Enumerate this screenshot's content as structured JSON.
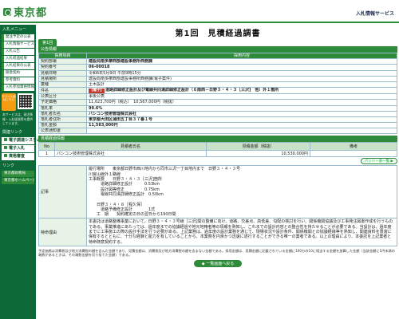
{
  "header": {
    "logo_text": "東京都",
    "right_title": "入札情報サービス"
  },
  "sidebar": {
    "menu_caption": "入札メニュー",
    "items": [
      "発注予定の公表",
      "入札情報サービス",
      "入札公告",
      "入札経過結果",
      "入札結果の公表",
      "随意契約",
      "参考資料",
      "入札参加資格情報"
    ],
    "mobile_text": "モバイル版はこちら",
    "note": "本サービスは、発注情報・入札経過等を提供しています。",
    "sys_caption": "関連リンク",
    "sys_items": [
      "電子調達システム(TOP)",
      "電子入札",
      "資格審査"
    ],
    "link_caption": "リンク",
    "links": [
      "東京都財務局",
      "東京都ホームページ"
    ]
  },
  "main": {
    "title": "第1回　見積経過調書",
    "tab": "第1回",
    "info_section": "公告情報",
    "col_item": "採用項目",
    "col_content": "採用内容",
    "rows": [
      {
        "label": "契約部署",
        "value": "建設局南多摩西部建設事務所西務課"
      },
      {
        "label": "契約番号",
        "value": "06-00018"
      },
      {
        "label": "見積日時",
        "value": "令和6年5月9日 午前9時15分"
      },
      {
        "label": "見積場所",
        "value": "建設局南多摩西部建設事務所西務課(電子案件)"
      },
      {
        "label": "業種",
        "value": "土木設計"
      },
      {
        "label": "件名",
        "tag": "【電子】",
        "value": "道路詳細修正設計及び電線共同溝詳細修正設計（６南西－日野３・４・３［三沢]　他）外１箇所"
      },
      {
        "label": "公表区分",
        "value": "事後公表"
      },
      {
        "label": "予定価格",
        "value": "11,623,700円（税込）　10,567,000円（税抜）"
      },
      {
        "label": "落札率",
        "value": "99.6%"
      },
      {
        "label": "落札者氏名",
        "value": "パシコン技術管理株式会社"
      },
      {
        "label": "落札者住所",
        "value": "東京都大田区蒲田五丁目３７番１号"
      },
      {
        "label": "落札金額",
        "value": "11,583,000円"
      },
      {
        "label": "公表通知書",
        "value": ""
      }
    ],
    "result_section": "見積経過情報",
    "result_cols": [
      "No",
      "見積者氏名",
      "見積金額（税抜）",
      "備考"
    ],
    "result_rows": [
      {
        "no": "1",
        "name": "パシコン技術管理株式会社",
        "amount": "10,530,000円",
        "note": ""
      }
    ],
    "detail_button": "パッシー表一覧",
    "notes_label": "記事",
    "notes": "履行場所　　東京都日野市西川地内から同市三沢一丁目地内まで　日野３・４・３号\n川宮山線外１路線\n工事概要　　日野３・４・３［三沢]箇所\n　　　道路詳細修正設計　　　0.53km\n　　　設計図等修正　　　　　0.75km\n　　　電線共同溝詳細修正設計　0.50km\n\n　　日野３・４・８［程久保］\n　　　道路予備修正設計　　　　1式\n　　工　期　　契約確定の日の翌日から190日間",
    "special_label": "特命理由",
    "special": "本委託は道路整備事業において、日野３・４・３号線［三沢]間の整備に向け、道路、交差点、高低差、勾配の検討を行い、関係機関協議及び工事発注図書作成を行うものである。事業推進にあたっては、過年度までの協議経過や地元地権者等の情報を熟知し、これまでの設計内容との整合性を持たせることが必要である。当設計は、過年度までに工事施工の際の設計手法を行う必要がある。上記業務は、過年度の設計業務を通じて、現場状況や設計条件、関係機関との協議経緯等を熟知し、関連資料を豊富に保有するとともに、十分な経験と能力を有していることから、本業務を円滑かつ迅速に遂行することができる唯一の業者である。以上の理由により、本委託を上記業者と特命随意契約する。",
    "footnote": "予定価格は消費税及び地方消費税の額を含んだ金額であり、見積金額は、消費税及び地方消費税の額を含まない金額である。採用金額は、見積金額に記載されている金額に100分の10に相当する金額を加算した金額（当該金額に1円未満の端数があるときは、その端数金額を切り捨てた金額）である。",
    "back_button": "一覧画面へ戻る"
  }
}
